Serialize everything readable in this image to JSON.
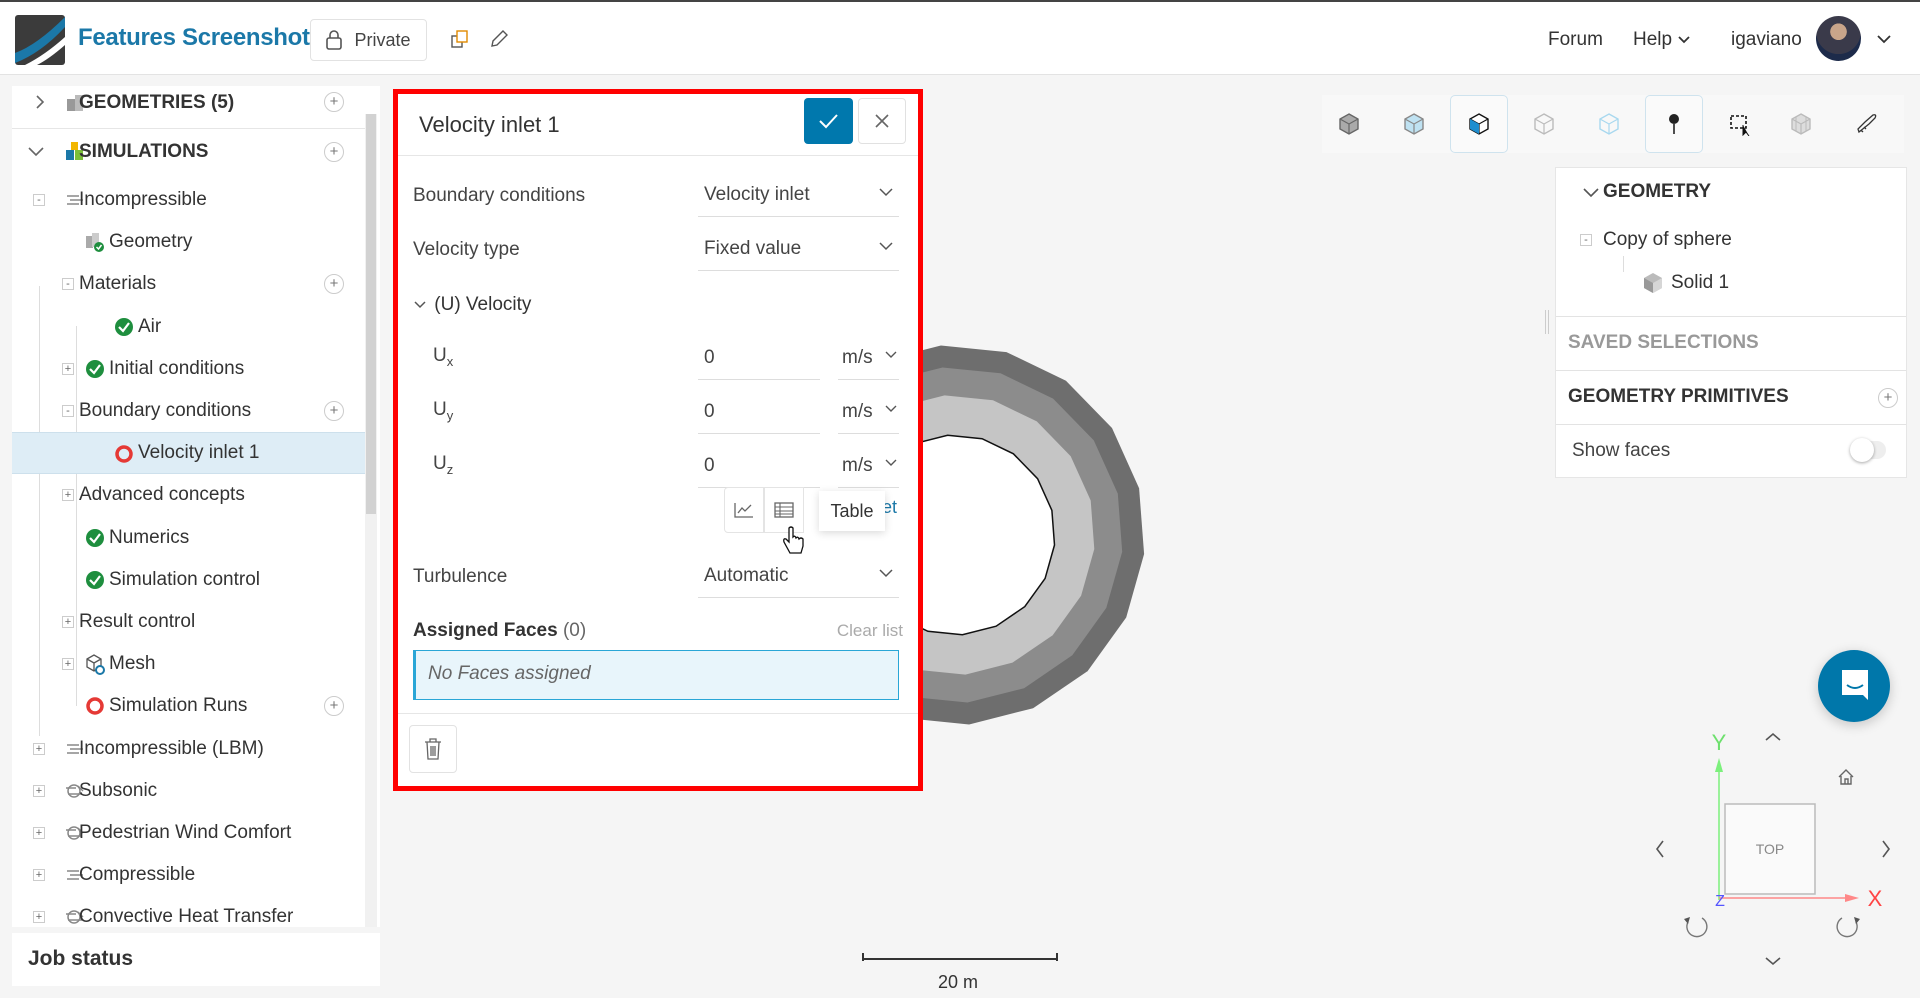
{
  "header": {
    "title": "Features Screenshot",
    "private_label": "Private",
    "forum": "Forum",
    "help": "Help",
    "username": "igaviano"
  },
  "tree": {
    "geometries": "GEOMETRIES (5)",
    "simulations": "SIMULATIONS",
    "items": [
      "Incompressible",
      "Geometry",
      "Materials",
      "Air",
      "Initial conditions",
      "Boundary conditions",
      "Velocity inlet 1",
      "Advanced concepts",
      "Numerics",
      "Simulation control",
      "Result control",
      "Mesh",
      "Simulation Runs",
      "Incompressible (LBM)",
      "Subsonic",
      "Pedestrian Wind Comfort",
      "Compressible",
      "Convective Heat Transfer"
    ]
  },
  "job_status": "Job status",
  "panel": {
    "title": "Velocity inlet 1",
    "boundary_label": "Boundary conditions",
    "boundary_value": "Velocity inlet",
    "vtype_label": "Velocity type",
    "vtype_value": "Fixed value",
    "velocity_section": "(U) Velocity",
    "components": [
      {
        "sym": "U",
        "sub": "x",
        "value": "0",
        "unit": "m/s"
      },
      {
        "sym": "U",
        "sub": "y",
        "value": "0",
        "unit": "m/s"
      },
      {
        "sym": "U",
        "sub": "z",
        "value": "0",
        "unit": "m/s"
      }
    ],
    "tooltip": "Table",
    "link_fragment": "et",
    "turbulence_label": "Turbulence",
    "turbulence_value": "Automatic",
    "assigned_label": "Assigned Faces",
    "assigned_count": "(0)",
    "clear_list": "Clear list",
    "no_faces": "No Faces assigned"
  },
  "right_panel": {
    "geometry": "GEOMETRY",
    "copy": "Copy of sphere",
    "solid": "Solid 1",
    "saved": "SAVED SELECTIONS",
    "primitives": "GEOMETRY PRIMITIVES",
    "show_faces": "Show faces",
    "show_faces_on": false
  },
  "viewport": {
    "scale": "20 m",
    "cube_face": "TOP",
    "axes": {
      "x": "X",
      "y": "Y",
      "z": "Z"
    }
  },
  "colors": {
    "brand": "#1b78a8",
    "primary": "#0078ad",
    "highlight_border": "#ff0000",
    "success": "#1e8e3e",
    "error": "#e53935"
  }
}
